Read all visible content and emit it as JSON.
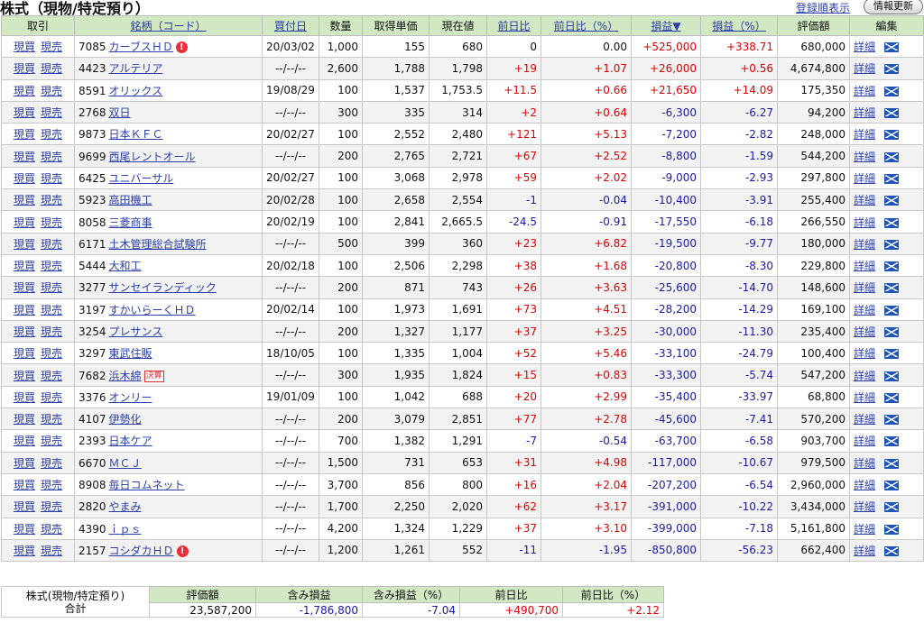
{
  "page": {
    "title": "株式（現物/特定預り）",
    "sort_link": "登録順表示",
    "refresh_button": "情報更新"
  },
  "columns": {
    "trade": "取引",
    "name": "銘柄（コード）",
    "buy_date": "買付日",
    "qty": "数量",
    "unit_cost": "取得単価",
    "price": "現在値",
    "change": "前日比",
    "change_pct": "前日比（%）",
    "pl": "損益▼",
    "pl_pct": "損益（%）",
    "value": "評価額",
    "edit": "編集"
  },
  "actions": {
    "buy": "現買",
    "sell": "現売",
    "detail": "詳細"
  },
  "colors": {
    "header_bg": "#d2e8c2",
    "positive": "#e00000",
    "negative": "#1a1aa8",
    "link": "#2b3fa8"
  },
  "rows": [
    {
      "code": "7085",
      "name": "カーブスＨＤ",
      "badge": "alert",
      "buy_date": "20/03/02",
      "qty": "1,000",
      "unit_cost": "155",
      "price": "680",
      "change": "0",
      "change_pct": "0.00",
      "pl": "+525,000",
      "pl_pct": "+338.71",
      "value": "680,000"
    },
    {
      "code": "4423",
      "name": "アルテリア",
      "badge": "",
      "buy_date": "--/--/--",
      "qty": "2,600",
      "unit_cost": "1,788",
      "price": "1,798",
      "change": "+19",
      "change_pct": "+1.07",
      "pl": "+26,000",
      "pl_pct": "+0.56",
      "value": "4,674,800"
    },
    {
      "code": "8591",
      "name": "オリックス",
      "badge": "",
      "buy_date": "19/08/29",
      "qty": "100",
      "unit_cost": "1,537",
      "price": "1,753.5",
      "change": "+11.5",
      "change_pct": "+0.66",
      "pl": "+21,650",
      "pl_pct": "+14.09",
      "value": "175,350"
    },
    {
      "code": "2768",
      "name": "双日",
      "badge": "",
      "buy_date": "--/--/--",
      "qty": "300",
      "unit_cost": "335",
      "price": "314",
      "change": "+2",
      "change_pct": "+0.64",
      "pl": "-6,300",
      "pl_pct": "-6.27",
      "value": "94,200"
    },
    {
      "code": "9873",
      "name": "日本ＫＦＣ",
      "badge": "",
      "buy_date": "20/02/27",
      "qty": "100",
      "unit_cost": "2,552",
      "price": "2,480",
      "change": "+121",
      "change_pct": "+5.13",
      "pl": "-7,200",
      "pl_pct": "-2.82",
      "value": "248,000"
    },
    {
      "code": "9699",
      "name": "西尾レントオール",
      "badge": "",
      "buy_date": "--/--/--",
      "qty": "200",
      "unit_cost": "2,765",
      "price": "2,721",
      "change": "+67",
      "change_pct": "+2.52",
      "pl": "-8,800",
      "pl_pct": "-1.59",
      "value": "544,200"
    },
    {
      "code": "6425",
      "name": "ユニバーサル",
      "badge": "",
      "buy_date": "20/02/27",
      "qty": "100",
      "unit_cost": "3,068",
      "price": "2,978",
      "change": "+59",
      "change_pct": "+2.02",
      "pl": "-9,000",
      "pl_pct": "-2.93",
      "value": "297,800"
    },
    {
      "code": "5923",
      "name": "高田機工",
      "badge": "",
      "buy_date": "20/02/28",
      "qty": "100",
      "unit_cost": "2,658",
      "price": "2,554",
      "change": "-1",
      "change_pct": "-0.04",
      "pl": "-10,400",
      "pl_pct": "-3.91",
      "value": "255,400"
    },
    {
      "code": "8058",
      "name": "三菱商事",
      "badge": "",
      "buy_date": "20/02/19",
      "qty": "100",
      "unit_cost": "2,841",
      "price": "2,665.5",
      "change": "-24.5",
      "change_pct": "-0.91",
      "pl": "-17,550",
      "pl_pct": "-6.18",
      "value": "266,550"
    },
    {
      "code": "6171",
      "name": "土木管理総合試験所",
      "badge": "",
      "buy_date": "--/--/--",
      "qty": "500",
      "unit_cost": "399",
      "price": "360",
      "change": "+23",
      "change_pct": "+6.82",
      "pl": "-19,500",
      "pl_pct": "-9.77",
      "value": "180,000"
    },
    {
      "code": "5444",
      "name": "大和工",
      "badge": "",
      "buy_date": "20/02/18",
      "qty": "100",
      "unit_cost": "2,506",
      "price": "2,298",
      "change": "+38",
      "change_pct": "+1.68",
      "pl": "-20,800",
      "pl_pct": "-8.30",
      "value": "229,800"
    },
    {
      "code": "3277",
      "name": "サンセイランディック",
      "badge": "",
      "buy_date": "--/--/--",
      "qty": "200",
      "unit_cost": "871",
      "price": "743",
      "change": "+26",
      "change_pct": "+3.63",
      "pl": "-25,600",
      "pl_pct": "-14.70",
      "value": "148,600"
    },
    {
      "code": "3197",
      "name": "すかいらーくＨＤ",
      "badge": "",
      "buy_date": "20/02/14",
      "qty": "100",
      "unit_cost": "1,973",
      "price": "1,691",
      "change": "+73",
      "change_pct": "+4.51",
      "pl": "-28,200",
      "pl_pct": "-14.29",
      "value": "169,100"
    },
    {
      "code": "3254",
      "name": "プレサンス",
      "badge": "",
      "buy_date": "--/--/--",
      "qty": "200",
      "unit_cost": "1,327",
      "price": "1,177",
      "change": "+37",
      "change_pct": "+3.25",
      "pl": "-30,000",
      "pl_pct": "-11.30",
      "value": "235,400"
    },
    {
      "code": "3297",
      "name": "東武住販",
      "badge": "",
      "buy_date": "18/10/05",
      "qty": "100",
      "unit_cost": "1,335",
      "price": "1,004",
      "change": "+52",
      "change_pct": "+5.46",
      "pl": "-33,100",
      "pl_pct": "-24.79",
      "value": "100,400"
    },
    {
      "code": "7682",
      "name": "浜木綿",
      "badge": "kessan",
      "badge_text": "決算",
      "buy_date": "--/--/--",
      "qty": "300",
      "unit_cost": "1,935",
      "price": "1,824",
      "change": "+15",
      "change_pct": "+0.83",
      "pl": "-33,300",
      "pl_pct": "-5.74",
      "value": "547,200"
    },
    {
      "code": "3376",
      "name": "オンリー",
      "badge": "",
      "buy_date": "19/01/09",
      "qty": "100",
      "unit_cost": "1,042",
      "price": "688",
      "change": "+20",
      "change_pct": "+2.99",
      "pl": "-35,400",
      "pl_pct": "-33.97",
      "value": "68,800"
    },
    {
      "code": "4107",
      "name": "伊勢化",
      "badge": "",
      "buy_date": "--/--/--",
      "qty": "200",
      "unit_cost": "3,079",
      "price": "2,851",
      "change": "+77",
      "change_pct": "+2.78",
      "pl": "-45,600",
      "pl_pct": "-7.41",
      "value": "570,200"
    },
    {
      "code": "2393",
      "name": "日本ケア",
      "badge": "",
      "buy_date": "--/--/--",
      "qty": "700",
      "unit_cost": "1,382",
      "price": "1,291",
      "change": "-7",
      "change_pct": "-0.54",
      "pl": "-63,700",
      "pl_pct": "-6.58",
      "value": "903,700"
    },
    {
      "code": "6670",
      "name": "ＭＣＪ",
      "badge": "",
      "buy_date": "--/--/--",
      "qty": "1,500",
      "unit_cost": "731",
      "price": "653",
      "change": "+31",
      "change_pct": "+4.98",
      "pl": "-117,000",
      "pl_pct": "-10.67",
      "value": "979,500"
    },
    {
      "code": "8908",
      "name": "毎日コムネット",
      "badge": "",
      "buy_date": "--/--/--",
      "qty": "3,700",
      "unit_cost": "856",
      "price": "800",
      "change": "+16",
      "change_pct": "+2.04",
      "pl": "-207,200",
      "pl_pct": "-6.54",
      "value": "2,960,000"
    },
    {
      "code": "2820",
      "name": "やまみ",
      "badge": "",
      "buy_date": "--/--/--",
      "qty": "1,700",
      "unit_cost": "2,250",
      "price": "2,020",
      "change": "+62",
      "change_pct": "+3.17",
      "pl": "-391,000",
      "pl_pct": "-10.22",
      "value": "3,434,000"
    },
    {
      "code": "4390",
      "name": "ｉｐｓ",
      "badge": "",
      "buy_date": "--/--/--",
      "qty": "4,200",
      "unit_cost": "1,324",
      "price": "1,229",
      "change": "+37",
      "change_pct": "+3.10",
      "pl": "-399,000",
      "pl_pct": "-7.18",
      "value": "5,161,800"
    },
    {
      "code": "2157",
      "name": "コシダカＨＤ",
      "badge": "alert",
      "buy_date": "--/--/--",
      "qty": "1,200",
      "unit_cost": "1,261",
      "price": "552",
      "change": "-11",
      "change_pct": "-1.95",
      "pl": "-850,800",
      "pl_pct": "-56.23",
      "value": "662,400"
    }
  ],
  "summary": {
    "label_line1": "株式(現物/特定預り)",
    "label_line2": "合計",
    "headers": {
      "value": "評価額",
      "pl": "含み損益",
      "pl_pct": "含み損益（%）",
      "change": "前日比",
      "change_pct": "前日比（%）"
    },
    "values": {
      "value": "23,587,200",
      "pl": "-1,786,800",
      "pl_pct": "-7.04",
      "change": "+490,700",
      "change_pct": "+2.12"
    }
  }
}
